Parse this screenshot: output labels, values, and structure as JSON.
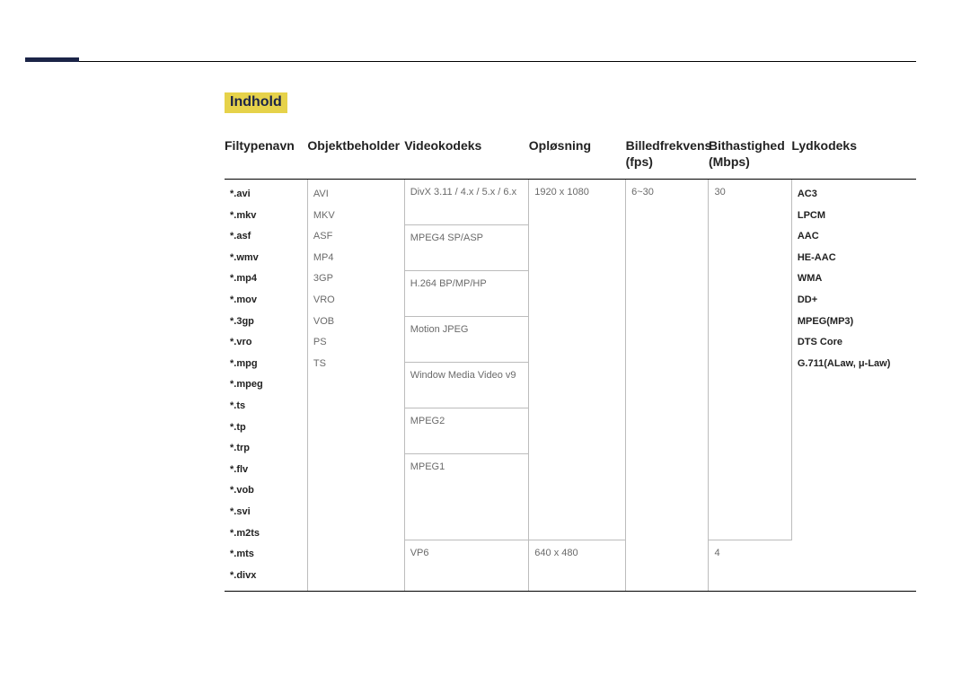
{
  "breadcrumb": "Indhold",
  "headers": {
    "filename": "Filtypenavn",
    "container": "Objektbeholder",
    "vcodec": "Videokodeks",
    "resolution": "Opløsning",
    "fps": "Billedfrekvens (fps)",
    "bitrate": "Bithastighed (Mbps)",
    "acodec": "Lydkodeks"
  },
  "file_types": [
    "*.avi",
    "*.mkv",
    "*.asf",
    "*.wmv",
    "*.mp4",
    "*.mov",
    "*.3gp",
    "*.vro",
    "*.mpg",
    "*.mpeg",
    "*.ts",
    "*.tp",
    "*.trp",
    "*.flv",
    "*.vob",
    "*.svi",
    "*.m2ts",
    "*.mts",
    "*.divx"
  ],
  "containers": [
    "AVI",
    "MKV",
    "ASF",
    "MP4",
    "3GP",
    "VRO",
    "VOB",
    "PS",
    "TS"
  ],
  "vcodecs_main": [
    "DivX 3.11 / 4.x / 5.x / 6.x",
    "MPEG4 SP/ASP",
    "H.264 BP/MP/HP",
    "Motion JPEG",
    "Window Media Video v9",
    "MPEG2",
    "MPEG1"
  ],
  "vcodec_row2": "VP6",
  "res_row1": "1920 x 1080",
  "res_row2": "640 x 480",
  "fps_row1": "6~30",
  "bitrate_row1": "30",
  "bitrate_row2": "4",
  "acodecs": [
    "AC3",
    "LPCM",
    "AAC",
    "HE-AAC",
    "WMA",
    "DD+",
    "MPEG(MP3)",
    "DTS Core",
    "G.711(ALaw, μ-Law)"
  ]
}
